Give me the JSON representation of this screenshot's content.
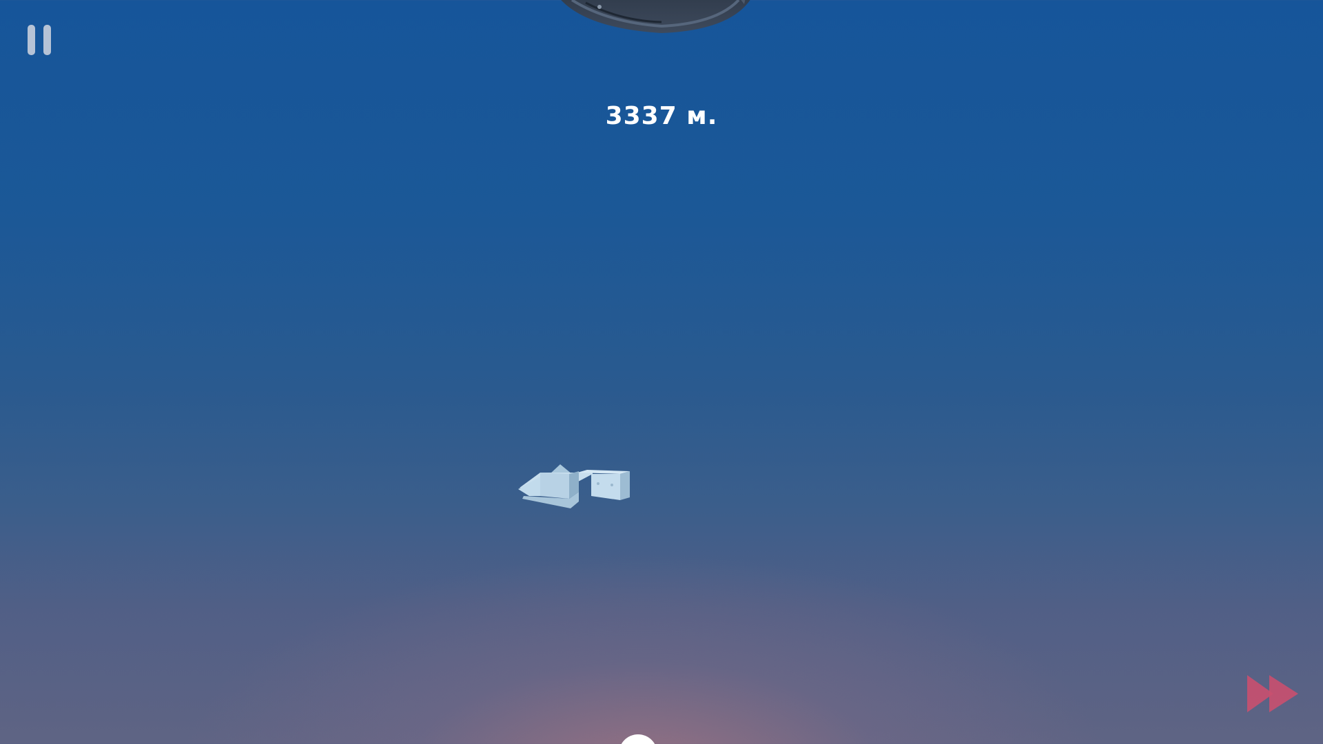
{
  "hud": {
    "distance_label": "3337 м.",
    "pause_icon": "pause-icon",
    "fast_forward_icon": "fast-forward-icon"
  },
  "scene": {
    "player": "paper-plane-ship",
    "obstacle": "ufo-saucer",
    "colors": {
      "sky_top": "#16559a",
      "sky_bottom": "#5f6484",
      "glow": "#a07382",
      "ship": "#b9d3e6",
      "fast_forward": "#c9506f",
      "pause": "#b6c3d6"
    }
  }
}
